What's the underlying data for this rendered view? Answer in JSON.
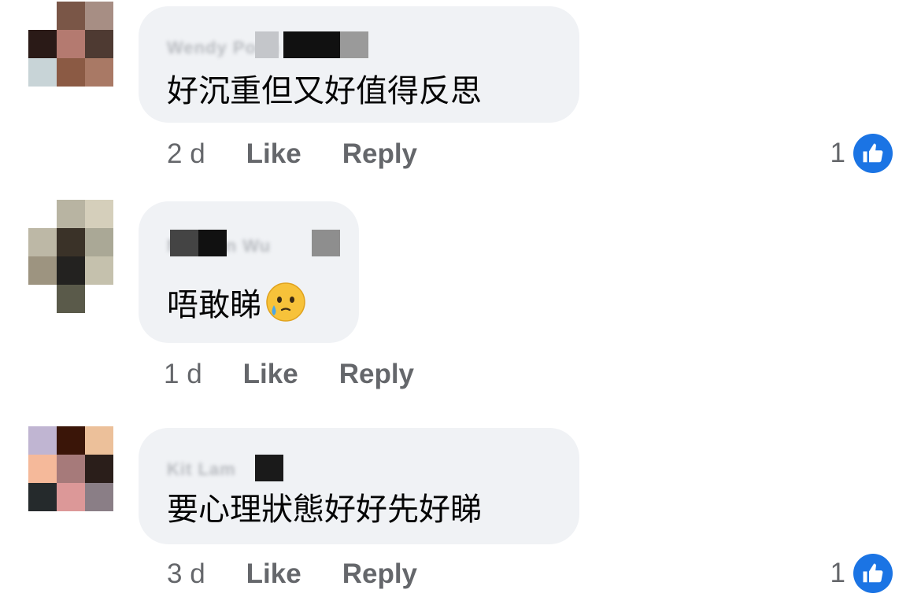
{
  "comments": [
    {
      "author": "Wendy Poon",
      "text": "好沉重但又好值得反思",
      "emoji": "",
      "time": "2 d",
      "like_label": "Like",
      "reply_label": "Reply",
      "reaction_count": "1",
      "avatar_colors": [
        "#ffffff",
        "#7a5647",
        "#a78e84",
        "#2a1a17",
        "#b47a70",
        "#4e3a32",
        "#c8d4d7",
        "#8b5a44",
        "#a97965"
      ]
    },
    {
      "author": "Manson Wu",
      "text": "唔敢睇",
      "emoji": "face-holding-back-tears",
      "time": "1 d",
      "like_label": "Like",
      "reply_label": "Reply",
      "reaction_count": "",
      "avatar_colors": [
        "#ffffff",
        "#b8b4a2",
        "#d5cfbb",
        "#bdb8a6",
        "#3a3228",
        "#aaa896",
        "#9d9480",
        "#232220",
        "#c5c1ad"
      ]
    },
    {
      "author": "Kit Lam",
      "text": "要心理狀態好好先好睇",
      "emoji": "",
      "time": "3 d",
      "like_label": "Like",
      "reply_label": "Reply",
      "reaction_count": "1",
      "avatar_colors": [
        "#c0b5d2",
        "#3a1508",
        "#ecc09a",
        "#f5b99a",
        "#a67a7a",
        "#2a1e1a",
        "#252a2c",
        "#dc9898",
        "#8a7e86"
      ]
    }
  ],
  "colors": {
    "bubble": "#f0f2f5",
    "meta_text": "#65676b",
    "like_blue": "#1b74e4"
  },
  "icons": {
    "like_reaction": "thumbs-up-icon"
  }
}
